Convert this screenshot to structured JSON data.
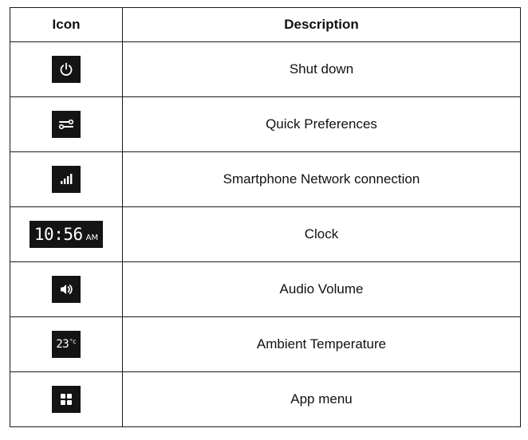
{
  "table": {
    "headers": {
      "icon": "Icon",
      "description": "Description"
    },
    "rows": [
      {
        "icon": "power-icon",
        "description": "Shut down"
      },
      {
        "icon": "toggles-icon",
        "description": "Quick Preferences"
      },
      {
        "icon": "signal-bars-icon",
        "description": "Smartphone Network connection"
      },
      {
        "icon": "clock-display",
        "clock_time": "10:56",
        "clock_ampm": "AM",
        "description": "Clock"
      },
      {
        "icon": "speaker-icon",
        "description": "Audio Volume"
      },
      {
        "icon": "temperature-display",
        "temp_value": "23",
        "temp_unit": "°c",
        "description": "Ambient Temperature"
      },
      {
        "icon": "grid-icon",
        "description": "App menu"
      }
    ]
  },
  "colors": {
    "icon_background": "#141414",
    "icon_foreground": "#ffffff",
    "border": "#1a1a1a"
  }
}
